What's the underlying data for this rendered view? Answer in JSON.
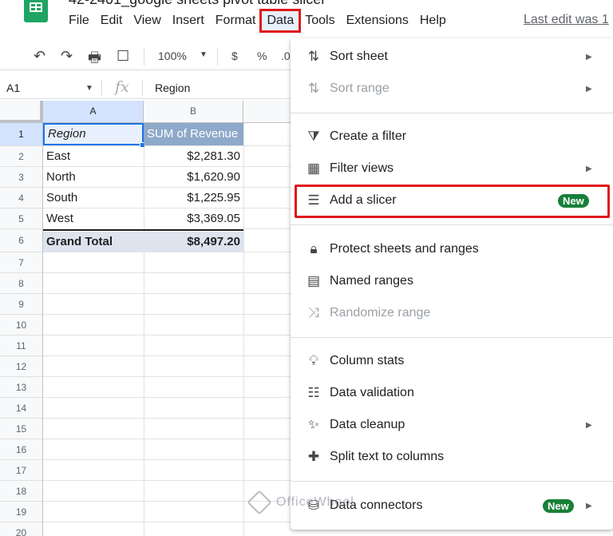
{
  "document": {
    "title": "42-2401_google sheets pivot table slicer"
  },
  "menubar": {
    "items": [
      "File",
      "Edit",
      "View",
      "Insert",
      "Format",
      "Data",
      "Tools",
      "Extensions",
      "Help"
    ],
    "active": "Data",
    "last_edit": "Last edit was 1"
  },
  "toolbar": {
    "zoom": "100%",
    "currency": "$",
    "percent": "%",
    "decimal": ".0"
  },
  "formula_bar": {
    "cell_ref": "A1",
    "fx": "fx",
    "value": "Region"
  },
  "grid": {
    "columns": [
      "A",
      "B"
    ],
    "rows": [
      "1",
      "2",
      "3",
      "4",
      "5",
      "6",
      "7",
      "8",
      "9",
      "10",
      "11",
      "12",
      "13",
      "14",
      "15",
      "16",
      "17",
      "18",
      "19",
      "20"
    ],
    "pivot": {
      "header": [
        "Region",
        "SUM of Revenue"
      ],
      "rows": [
        [
          "East",
          "$2,281.30"
        ],
        [
          "North",
          "$1,620.90"
        ],
        [
          "South",
          "$1,225.95"
        ],
        [
          "West",
          "$3,369.05"
        ]
      ],
      "total": [
        "Grand Total",
        "$8,497.20"
      ]
    }
  },
  "data_menu": {
    "items": [
      {
        "label": "Sort sheet",
        "icon": "sort-icon",
        "submenu": true,
        "disabled": false
      },
      {
        "label": "Sort range",
        "icon": "sort-icon",
        "submenu": true,
        "disabled": true
      },
      {
        "label": "Create a filter",
        "icon": "filter-icon",
        "submenu": false,
        "disabled": false
      },
      {
        "label": "Filter views",
        "icon": "filter-views-icon",
        "submenu": true,
        "disabled": false
      },
      {
        "label": "Add a slicer",
        "icon": "slicer-icon",
        "submenu": false,
        "disabled": false,
        "badge": "New"
      },
      {
        "label": "Protect sheets and ranges",
        "icon": "lock-icon",
        "submenu": false,
        "disabled": false
      },
      {
        "label": "Named ranges",
        "icon": "named-ranges-icon",
        "submenu": false,
        "disabled": false
      },
      {
        "label": "Randomize range",
        "icon": "shuffle-icon",
        "submenu": false,
        "disabled": true
      },
      {
        "label": "Column stats",
        "icon": "lightbulb-icon",
        "submenu": false,
        "disabled": false
      },
      {
        "label": "Data validation",
        "icon": "data-validation-icon",
        "submenu": false,
        "disabled": false
      },
      {
        "label": "Data cleanup",
        "icon": "magic-wand-icon",
        "submenu": true,
        "disabled": false
      },
      {
        "label": "Split text to columns",
        "icon": "split-icon",
        "submenu": false,
        "disabled": false
      },
      {
        "label": "Data connectors",
        "icon": "database-icon",
        "submenu": true,
        "disabled": false,
        "badge": "New"
      }
    ]
  },
  "watermark": "OfficeWheel",
  "colors": {
    "accent_red": "#e0181b",
    "badge_green": "#188038",
    "selection_blue": "#1a73e8",
    "pivot_header": "#8ea9c9"
  }
}
